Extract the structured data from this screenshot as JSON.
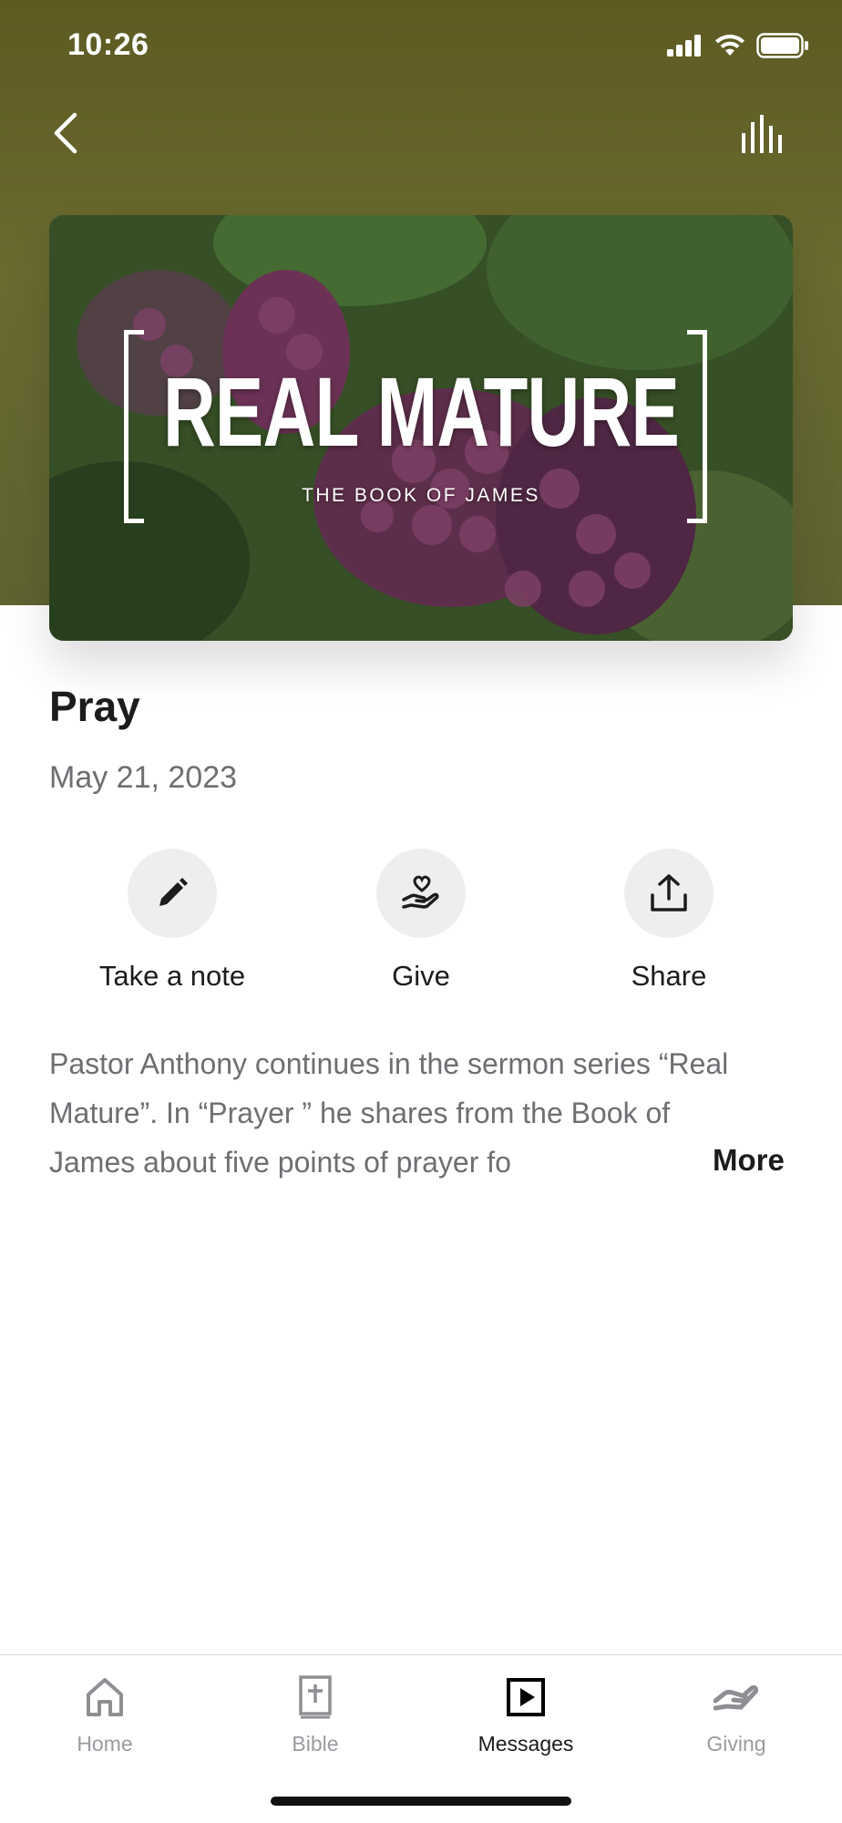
{
  "status_bar": {
    "time": "10:26"
  },
  "artwork": {
    "title": "REAL MATURE",
    "subtitle": "THE BOOK OF JAMES"
  },
  "message": {
    "title": "Pray",
    "date": "May 21, 2023"
  },
  "actions": [
    {
      "label": "Take a note",
      "icon": "pencil-icon"
    },
    {
      "label": "Give",
      "icon": "heart-hand-icon"
    },
    {
      "label": "Share",
      "icon": "share-icon"
    }
  ],
  "description": {
    "text": "Pastor Anthony continues in the sermon series “Real Mature”. In “Prayer ” he shares from the Book of James about five points of prayer fo",
    "more_label": "More"
  },
  "tabs": [
    {
      "label": "Home",
      "icon": "home-icon",
      "active": false
    },
    {
      "label": "Bible",
      "icon": "bible-icon",
      "active": false
    },
    {
      "label": "Messages",
      "icon": "play-icon",
      "active": true
    },
    {
      "label": "Giving",
      "icon": "giving-hand-icon",
      "active": false
    }
  ],
  "colors": {
    "header_bg": "#62612b",
    "text_primary": "#1c1c1e",
    "text_secondary": "#6e6e73",
    "tab_inactive": "#9a9aa0"
  }
}
